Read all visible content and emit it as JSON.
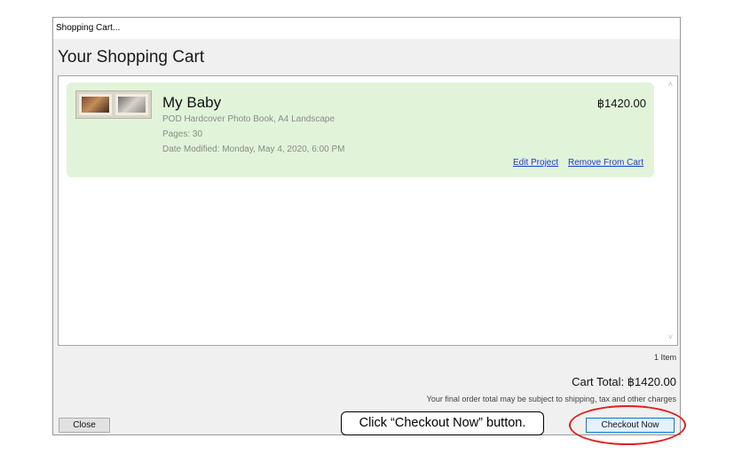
{
  "window": {
    "title": "Shopping Cart..."
  },
  "heading": "Your Shopping Cart",
  "cart": {
    "items": [
      {
        "title": "My Baby",
        "product": "POD Hardcover Photo Book, A4 Landscape",
        "pages": "Pages: 30",
        "modified": "Date Modified: Monday, May 4, 2020, 6:00 PM",
        "price": "฿1420.00",
        "edit_label": "Edit Project",
        "remove_label": "Remove From Cart"
      }
    ],
    "count": "1 Item",
    "total": "Cart Total: ฿1420.00",
    "disclaimer": "Your final order total may be subject to shipping, tax and other charges"
  },
  "buttons": {
    "close_label": "Close",
    "checkout_label": "Checkout Now"
  },
  "annotation": {
    "callout": "Click “Checkout Now” button.",
    "highlight_color": "#e02020"
  },
  "icons": {
    "scroll_up": "chevron-up-icon",
    "scroll_down": "chevron-down-icon"
  }
}
